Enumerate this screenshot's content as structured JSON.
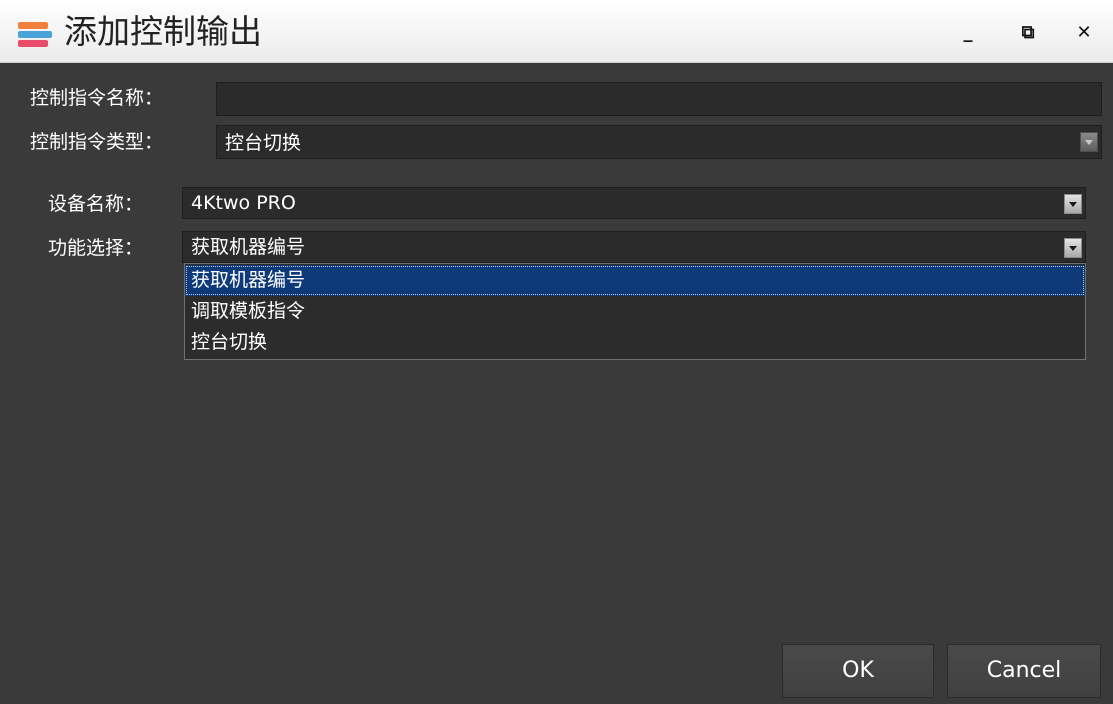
{
  "window": {
    "title": "添加控制输出",
    "controls": {
      "minimize": "_",
      "restore": "⧉",
      "close": "✕"
    }
  },
  "form": {
    "command_name": {
      "label": "控制指令名称：",
      "value": ""
    },
    "command_type": {
      "label": "控制指令类型：",
      "value": "控台切换"
    },
    "device_name": {
      "label": "设备名称：",
      "value": "4Ktwo PRO"
    },
    "function_select": {
      "label": "功能选择：",
      "value": "获取机器编号",
      "options": [
        "获取机器编号",
        "调取模板指令",
        "控台切换"
      ],
      "highlighted_index": 0
    }
  },
  "buttons": {
    "ok": "OK",
    "cancel": "Cancel"
  },
  "colors": {
    "background": "#3a3a3a",
    "field": "#2b2b2b",
    "selection": "#0f3a7a",
    "titlebar": "#ffffff"
  }
}
